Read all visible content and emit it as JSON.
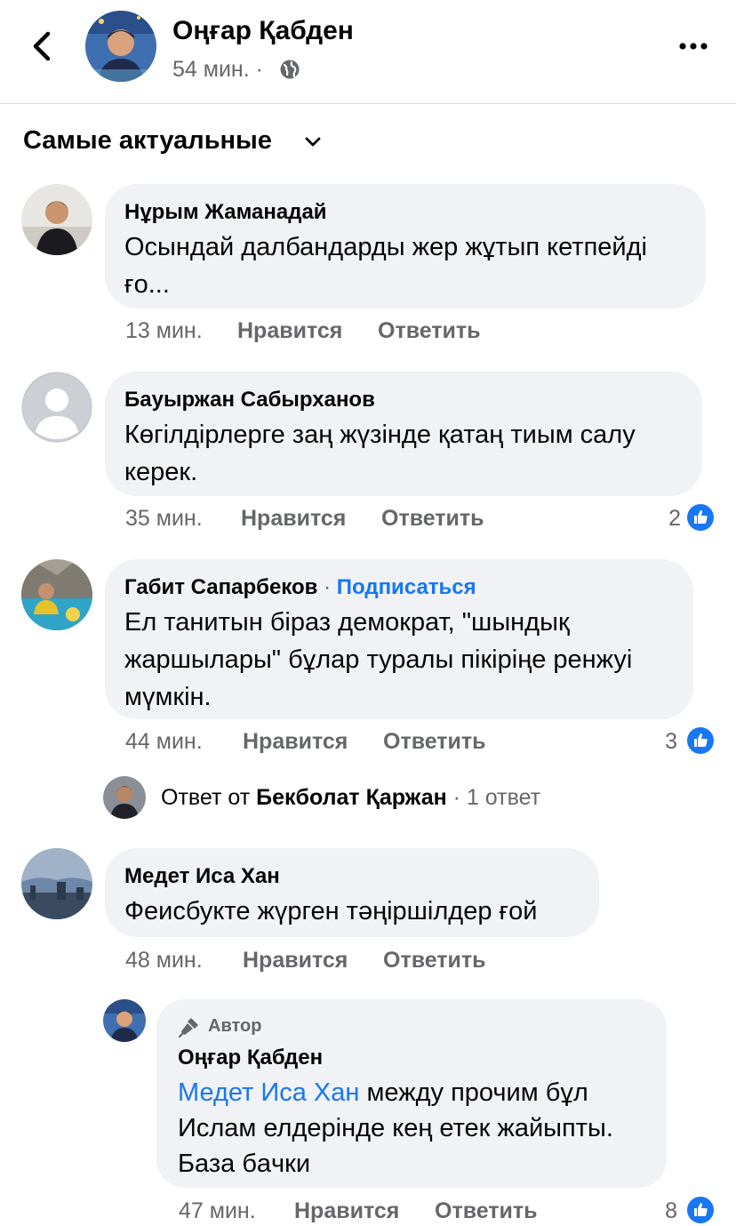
{
  "header": {
    "author": "Оңғар Қабден",
    "time": "54 мин. ·"
  },
  "sort_label": "Самые актуальные",
  "comments": [
    {
      "name": "Нұрым Жаманадай",
      "line1": "Осындай далбандарды жер жұтып кетпейді",
      "line2": "ғо...",
      "time": "13 мин.",
      "like_label": "Нравится",
      "reply_label": "Ответить"
    },
    {
      "name": "Бауыржан Сабырханов",
      "line1": "Көгілдірлерге заң жүзінде қатаң тиым салу",
      "line2": "керек.",
      "time": "35 мин.",
      "like_label": "Нравится",
      "reply_label": "Ответить",
      "likes": "2"
    },
    {
      "name": "Габит Сапарбеков",
      "follow": "Подписаться",
      "line1": "Ел танитын біраз демократ, \"шындық",
      "line2": "жаршылары\" бұлар туралы пікіріңе ренжуі",
      "line3": "мүмкін.",
      "time": "44 мин.",
      "like_label": "Нравится",
      "reply_label": "Ответить",
      "likes": "3",
      "replies_summary": {
        "prefix": "Ответ от",
        "name": "Бекболат Қаржан",
        "count": "· 1 ответ"
      }
    },
    {
      "name": "Медет Иса Хан",
      "line1": "Феисбукте жүрген тәңіршілдер ғой",
      "time": "48 мин.",
      "like_label": "Нравится",
      "reply_label": "Ответить"
    }
  ],
  "author_reply": {
    "badge": "Автор",
    "name": "Оңғар Қабден",
    "mention": "Медет Иса Хан",
    "line1_rest": " между прочим бұл",
    "line2": "Ислам елдерінде кең етек жайыпты.",
    "line3": "База бaчки",
    "time": "47 мин.",
    "like_label": "Нравится",
    "reply_label": "Ответить",
    "likes": "8"
  },
  "colors": {
    "accent": "#1877f2",
    "bubble": "#f0f2f5",
    "secondary_text": "#65676b"
  }
}
